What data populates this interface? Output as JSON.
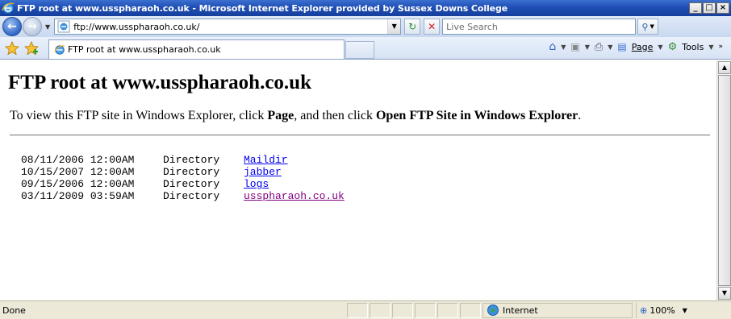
{
  "window": {
    "title": "FTP root at www.usspharaoh.co.uk - Microsoft Internet Explorer provided by Sussex Downs College"
  },
  "navbar": {
    "url": "ftp://www.usspharaoh.co.uk/",
    "search_placeholder": "Live Search"
  },
  "tabs": [
    {
      "label": "FTP root at www.usspharaoh.co.uk"
    }
  ],
  "commandbar": {
    "page_label": "Page",
    "tools_label": "Tools"
  },
  "page": {
    "title": "FTP root at www.usspharaoh.co.uk",
    "intro_prefix": "To view this FTP site in Windows Explorer, click ",
    "intro_page": "Page",
    "intro_middle": ", and then click ",
    "intro_action": "Open FTP Site in Windows Explorer",
    "intro_suffix": ".",
    "entries": [
      {
        "date": "08/11/2006 12:00AM",
        "kind": "Directory",
        "name": "Maildir"
      },
      {
        "date": "10/15/2007 12:00AM",
        "kind": "Directory",
        "name": "jabber"
      },
      {
        "date": "09/15/2006 12:00AM",
        "kind": "Directory",
        "name": "logs"
      },
      {
        "date": "03/11/2009 03:59AM",
        "kind": "Directory",
        "name": "usspharaoh.co.uk",
        "visited": true
      }
    ]
  },
  "statusbar": {
    "status": "Done",
    "zone": "Internet",
    "zoom": "100%"
  },
  "colors": {
    "link": "#0000ee",
    "visited_link": "#800080",
    "titlebar": "#1f4fb4"
  }
}
